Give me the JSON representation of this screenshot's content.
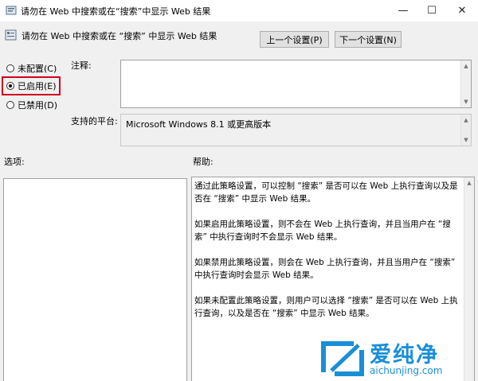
{
  "window": {
    "title": "请勿在 Web 中搜索或在“搜索”中显示 Web 结果",
    "minimize_glyph": "—",
    "maximize_glyph": "☐",
    "close_glyph": "✕"
  },
  "header": {
    "title": "请勿在 Web 中搜索或在 “搜索” 中显示 Web 结果",
    "prev_button": "上一个设置(P)",
    "next_button": "下一个设置(N)"
  },
  "options": [
    {
      "label": "未配置(C)",
      "checked": false
    },
    {
      "label": "已启用(E)",
      "checked": true
    },
    {
      "label": "已禁用(D)",
      "checked": false
    }
  ],
  "comment": {
    "label": "注释:",
    "value": ""
  },
  "platform": {
    "label": "支持的平台:",
    "value": "Microsoft Windows 8.1 或更高版本"
  },
  "options_section": {
    "label": "选项:"
  },
  "help_section": {
    "label": "帮助:",
    "paragraphs": [
      "通过此策略设置，可以控制 “搜索” 是否可以在 Web 上执行查询以及是否在 “搜索” 中显示 Web 结果。",
      "如果启用此策略设置，则不会在 Web 上执行查询，并且当用户在 “搜索” 中执行查询时不会显示 Web 结果。",
      "如果禁用此策略设置，则会在 Web 上执行查询，并且当用户在 “搜索” 中执行查询时会显示 Web 结果。",
      "如果未配置此策略设置，则用户可以选择 “搜索” 是否可以在 Web 上执行查询，以及是否在 “搜索” 中显示 Web 结果。"
    ]
  },
  "watermark": {
    "brand": "爱纯净",
    "url": "aichunjing.com"
  },
  "colors": {
    "highlight": "#d0021b",
    "brand_blue": "#1a8fd8"
  }
}
